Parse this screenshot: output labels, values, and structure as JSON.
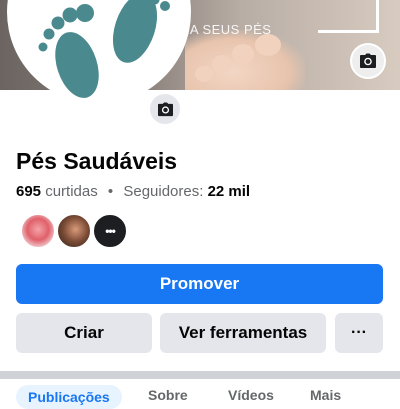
{
  "cover": {
    "text": "RA SEUS PÉS"
  },
  "profile": {
    "name": "Pés Saudáveis",
    "likes_count": "695",
    "likes_label": "curtidas",
    "separator": "•",
    "followers_label": "Seguidores:",
    "followers_count": "22 mil"
  },
  "actions": {
    "promote": "Promover",
    "create": "Criar",
    "tools": "Ver ferramentas",
    "more": "···"
  },
  "friends": [
    {
      "name": "friend-avatar-1"
    },
    {
      "name": "friend-avatar-2"
    },
    {
      "name": "more-friends"
    }
  ],
  "tabs": [
    {
      "label": "Publicações"
    },
    {
      "label": "Sobre"
    },
    {
      "label": "Vídeos"
    },
    {
      "label": "Mais"
    }
  ],
  "colors": {
    "brand_blue": "#1877f2",
    "logo_teal": "#4a8a8f",
    "secondary_gray": "#e4e6eb"
  }
}
